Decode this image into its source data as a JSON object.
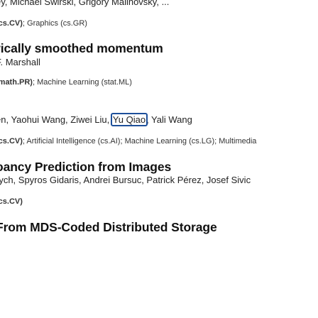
{
  "entries": [
    {
      "authors_line": "ey, Michael Swirski, Grigory Malinovsky, ...",
      "authors": [
        "Michael Swirski",
        "Grigory Malinovsky"
      ]
    },
    {
      "subjects_primary": "(cs.CV)",
      "subjects_rest": "; Graphics (cs.GR)"
    },
    {
      "title": "rically smoothed momentum",
      "authors_line": "F. Marshall"
    },
    {
      "subjects_primary": "(math.PR)",
      "subjects_rest": "; Machine Learning (stat.ML)"
    },
    {
      "authors_prefix": "en, Yaohui Wang, Ziwei Liu, ",
      "highlighted_author": "Yu Qiao",
      "authors_suffix": ", Yali Wang"
    },
    {
      "subjects_primary": "(cs.CV)",
      "subjects_rest": "; Artificial Intelligence (cs.AI); Machine Learning (cs.LG); Multimedia"
    },
    {
      "title": "oancy Prediction from Images",
      "authors_line": "rych, Spyros Gidaris, Andrei Bursuc, Patrick Pérez, Josef Sivic"
    },
    {
      "subjects_primary": "(cs.CV)",
      "subjects_rest": ""
    },
    {
      "title": "From MDS-Coded Distributed Storage"
    }
  ]
}
